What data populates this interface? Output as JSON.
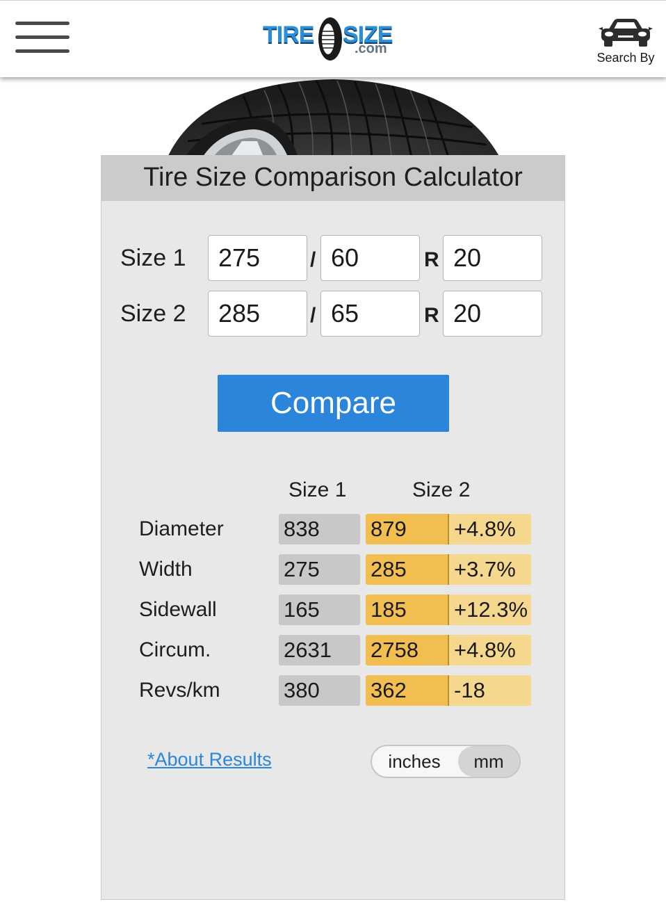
{
  "header": {
    "logo_tire": "TIRE",
    "logo_size": "SIZE",
    "logo_com": ".com",
    "search_by_label": "Search By"
  },
  "calculator": {
    "title": "Tire Size Comparison Calculator",
    "size1": {
      "label": "Size 1",
      "width": "275",
      "aspect": "60",
      "rim": "20"
    },
    "size2": {
      "label": "Size 2",
      "width": "285",
      "aspect": "65",
      "rim": "20"
    },
    "sep_slash": "/",
    "sep_r": "R",
    "compare_label": "Compare"
  },
  "results": {
    "col_size1": "Size 1",
    "col_size2": "Size 2",
    "rows": [
      {
        "label": "Diameter",
        "size1": "838",
        "size2": "879",
        "diff": "+4.8%"
      },
      {
        "label": "Width",
        "size1": "275",
        "size2": "285",
        "diff": "+3.7%"
      },
      {
        "label": "Sidewall",
        "size1": "165",
        "size2": "185",
        "diff": "+12.3%"
      },
      {
        "label": "Circum.",
        "size1": "2631",
        "size2": "2758",
        "diff": "+4.8%"
      },
      {
        "label": "Revs/km",
        "size1": "380",
        "size2": "362",
        "diff": "-18"
      }
    ]
  },
  "footer": {
    "about_link": "*About Results",
    "unit_inches": "inches",
    "unit_mm": "mm",
    "selected_unit": "mm"
  },
  "colors": {
    "accent_blue": "#2b86db",
    "size2_orange": "#f2be50",
    "diff_yellow": "#f5d78e",
    "size1_grey": "#c8c8c8",
    "panel_bg": "#e8e8e8"
  }
}
